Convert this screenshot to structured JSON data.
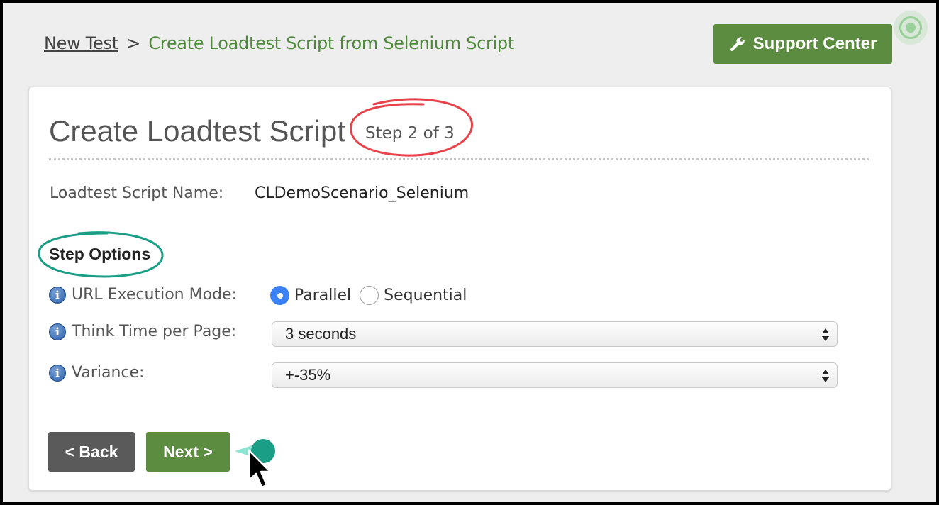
{
  "breadcrumb": {
    "link": "New Test",
    "separator": ">",
    "current": "Create Loadtest Script from Selenium Script"
  },
  "header": {
    "support_label": "Support Center",
    "support_icon": "wrench-icon"
  },
  "card": {
    "title": "Create Loadtest Script",
    "step": "Step 2 of 3",
    "name_label": "Loadtest Script Name:",
    "name_value": "CLDemoScenario_Selenium",
    "section_heading": "Step Options"
  },
  "options": {
    "url_mode": {
      "label": "URL Execution Mode:",
      "choices": [
        "Parallel",
        "Sequential"
      ],
      "selected": "Parallel"
    },
    "think_time": {
      "label": "Think Time per Page:",
      "value": "3 seconds"
    },
    "variance": {
      "label": "Variance:",
      "value": "+-35%"
    }
  },
  "buttons": {
    "back": "< Back",
    "next": "Next >"
  },
  "colors": {
    "brand_green": "#5b8c3f",
    "breadcrumb_green": "#4e8a3a",
    "annotation_red": "#e8424a",
    "annotation_teal": "#1a9e86",
    "radio_blue": "#3b82f6"
  }
}
